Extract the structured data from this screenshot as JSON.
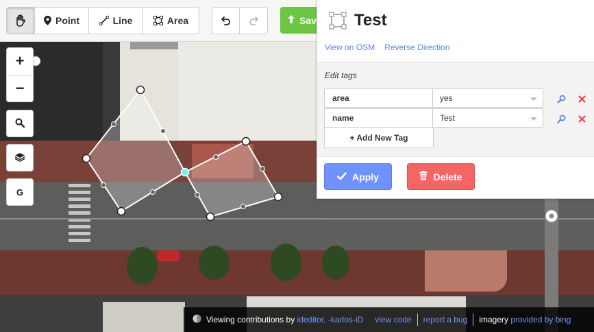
{
  "toolbar": {
    "browse_label": "",
    "point_label": "Point",
    "line_label": "Line",
    "area_label": "Area",
    "save_label": "Save"
  },
  "map_controls": {
    "zoom_in": "+",
    "zoom_out": "−",
    "geolocate": "G"
  },
  "inspector": {
    "title": "Test",
    "view_on_osm": "View on OSM",
    "reverse_direction": "Reverse Direction",
    "edit_tags_label": "Edit tags",
    "tags": [
      {
        "key": "area",
        "value": "yes"
      },
      {
        "key": "name",
        "value": "Test"
      }
    ],
    "add_tag_label": "+ Add New Tag",
    "apply_label": "Apply",
    "delete_label": "Delete"
  },
  "footer": {
    "viewing_text": "Viewing contributions by",
    "contributors": "ideditor, -karlos-iD",
    "view_code": "view code",
    "report_bug": "report a bug",
    "imagery_text": "imagery",
    "imagery_provider": "provided by bing"
  },
  "colors": {
    "accent_blue": "#7092ff",
    "save_green": "#6bc641",
    "delete_red": "#f46663",
    "link_blue": "#5f86e4",
    "vertex_selected": "#6ef3f5"
  },
  "icons": {
    "browse": "hand-icon",
    "point": "map-pin-icon",
    "line": "line-icon",
    "area": "area-icon",
    "undo": "undo-icon",
    "redo": "redo-icon",
    "search": "search-icon",
    "layers": "layers-icon",
    "info": "info-icon",
    "remove": "close-icon",
    "apply": "checkmark-icon",
    "delete": "trash-icon"
  }
}
